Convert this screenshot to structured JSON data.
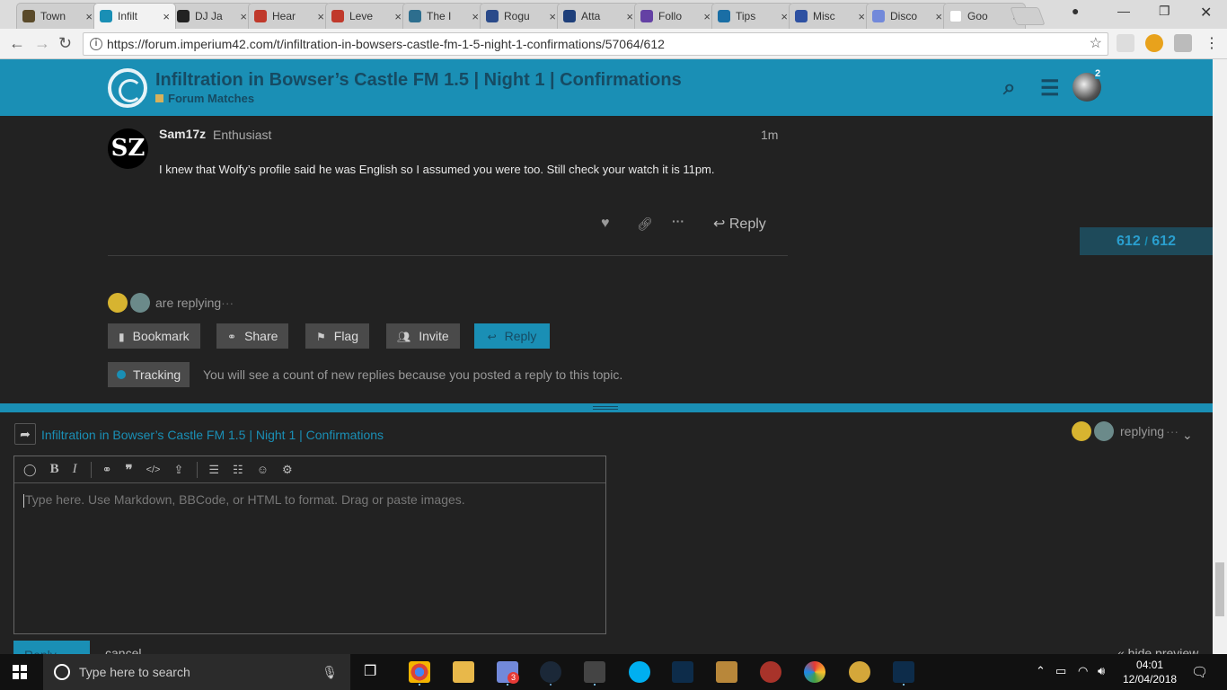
{
  "browser": {
    "tabs": [
      {
        "label": "Town",
        "color": "#5a4a2a"
      },
      {
        "label": "Infilt",
        "color": "#1a8fb5"
      },
      {
        "label": "DJ Ja",
        "color": "#222222"
      },
      {
        "label": "Hear",
        "color": "#c0392b"
      },
      {
        "label": "Leve",
        "color": "#c0392b"
      },
      {
        "label": "The I",
        "color": "#2d6e8e"
      },
      {
        "label": "Rogu",
        "color": "#2a4a8a"
      },
      {
        "label": "Atta",
        "color": "#1e3f7a"
      },
      {
        "label": "Follo",
        "color": "#6441a4"
      },
      {
        "label": "Tips",
        "color": "#1a6ea5"
      },
      {
        "label": "Misc",
        "color": "#2e51a2"
      },
      {
        "label": "Disco",
        "color": "#7289da"
      },
      {
        "label": "Goo",
        "color": "#ffffff"
      }
    ],
    "tab_close": "×",
    "url": "https://forum.imperium42.com/t/infiltration-in-bowsers-castle-fm-1-5-night-1-confirmations/57064/612"
  },
  "header": {
    "title": "Infiltration in Bowser’s Castle FM 1.5 | Night 1 | Confirmations",
    "category": "Forum Matches",
    "notification_count": "2"
  },
  "post": {
    "avatar_text": "SZ",
    "username": "Sam17z",
    "user_title": "Enthusiast",
    "time": "1m",
    "body": "I knew that Wolfy’s profile said he was English so I assumed you were too. Still check your watch it is 11pm.",
    "reply_label": "Reply"
  },
  "progress": {
    "current": "612",
    "sep": "/",
    "total": "612"
  },
  "replying_text": "are replying",
  "footer_buttons": {
    "bookmark": "Bookmark",
    "share": "Share",
    "flag": "Flag",
    "invite": "Invite",
    "reply": "Reply"
  },
  "tracking": {
    "label": "Tracking",
    "message": "You will see a count of new replies because you posted a reply to this topic."
  },
  "composer": {
    "topic_title": "Infiltration in Bowser’s Castle FM 1.5 | Night 1 | Confirmations",
    "replying_label": "replying",
    "placeholder": "Type here. Use Markdown, BBCode, or HTML to format. Drag or paste images.",
    "submit_label": "Reply",
    "cancel_label": "cancel",
    "hide_preview_label": "« hide preview"
  },
  "taskbar": {
    "search_placeholder": "Type here to search",
    "discord_badge": "3",
    "time": "04:01",
    "date": "12/04/2018"
  }
}
